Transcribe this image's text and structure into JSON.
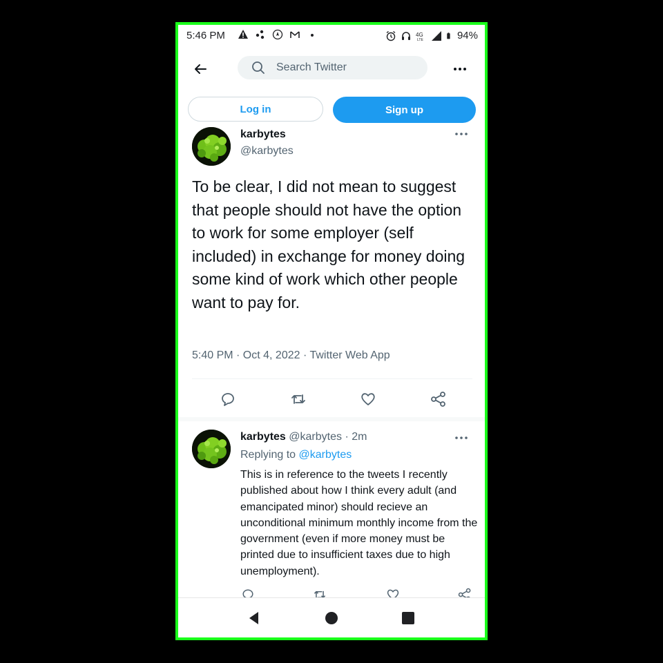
{
  "status_bar": {
    "time": "5:46 PM",
    "battery": "94%",
    "left_icons": [
      "warning-icon",
      "dots-icon",
      "location-icon",
      "gmail-icon",
      "dot-icon"
    ],
    "right_icons": [
      "alarm-icon",
      "headset-icon",
      "4g-lte-icon",
      "signal-icon",
      "battery-icon"
    ]
  },
  "top_nav": {
    "search_placeholder": "Search Twitter"
  },
  "auth": {
    "login_label": "Log in",
    "signup_label": "Sign up"
  },
  "main_tweet": {
    "name": "karbytes",
    "handle": "@karbytes",
    "text": "To be clear, I did not mean to suggest that people should not have the option to work for some employer (self included) in exchange for money doing some kind of work which other people want to pay for.",
    "meta": "5:40 PM · Oct 4, 2022 · Twitter Web App"
  },
  "reply_tweet": {
    "name": "karbytes",
    "handle_time": "@karbytes · 2m",
    "replying_prefix": "Replying to",
    "replying_mention": "@karbytes",
    "text": "This is in reference to the tweets I recently published about how I think every adult (and emancipated minor) should recieve an unconditional minimum monthly income from the government (even if more money must be printed due to insufficient taxes due to high unemployment)."
  },
  "colors": {
    "accent": "#1d9bf0",
    "frame": "#1aff1a",
    "text": "#0f1419",
    "secondary": "#536471"
  }
}
